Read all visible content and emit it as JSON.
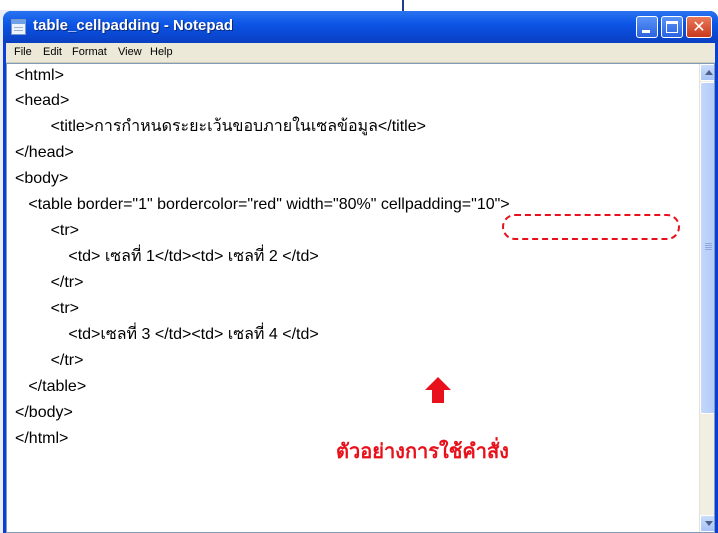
{
  "window": {
    "title": "table_cellpadding - Notepad",
    "accent_color": "#0a3fd6",
    "icon": "notepad-icon"
  },
  "menu": {
    "items": [
      "File",
      "Edit",
      "Format",
      "View",
      "Help"
    ]
  },
  "editor": {
    "lines": [
      "<html>",
      "<head>",
      "        <title>การกำหนดระยะเว้นขอบภายในเซลข้อมูล</title>",
      "</head>",
      "<body>",
      "   <table border=\"1\" bordercolor=\"red\" width=\"80%\" cellpadding=\"10\">",
      "        <tr>",
      "            <td> เซลที่ 1</td><td> เซลที่ 2 </td>",
      "        </tr>",
      "        <tr>",
      "            <td>เซลที่ 3 </td><td> เซลที่ 4 </td>",
      "        </tr>",
      "   </table>",
      "</body>",
      "</html>"
    ]
  },
  "annotation": {
    "text": "ตัวอย่างการใช้คำสั่ง",
    "color": "#e8101a",
    "arrow_icon": "arrow-up-icon"
  }
}
